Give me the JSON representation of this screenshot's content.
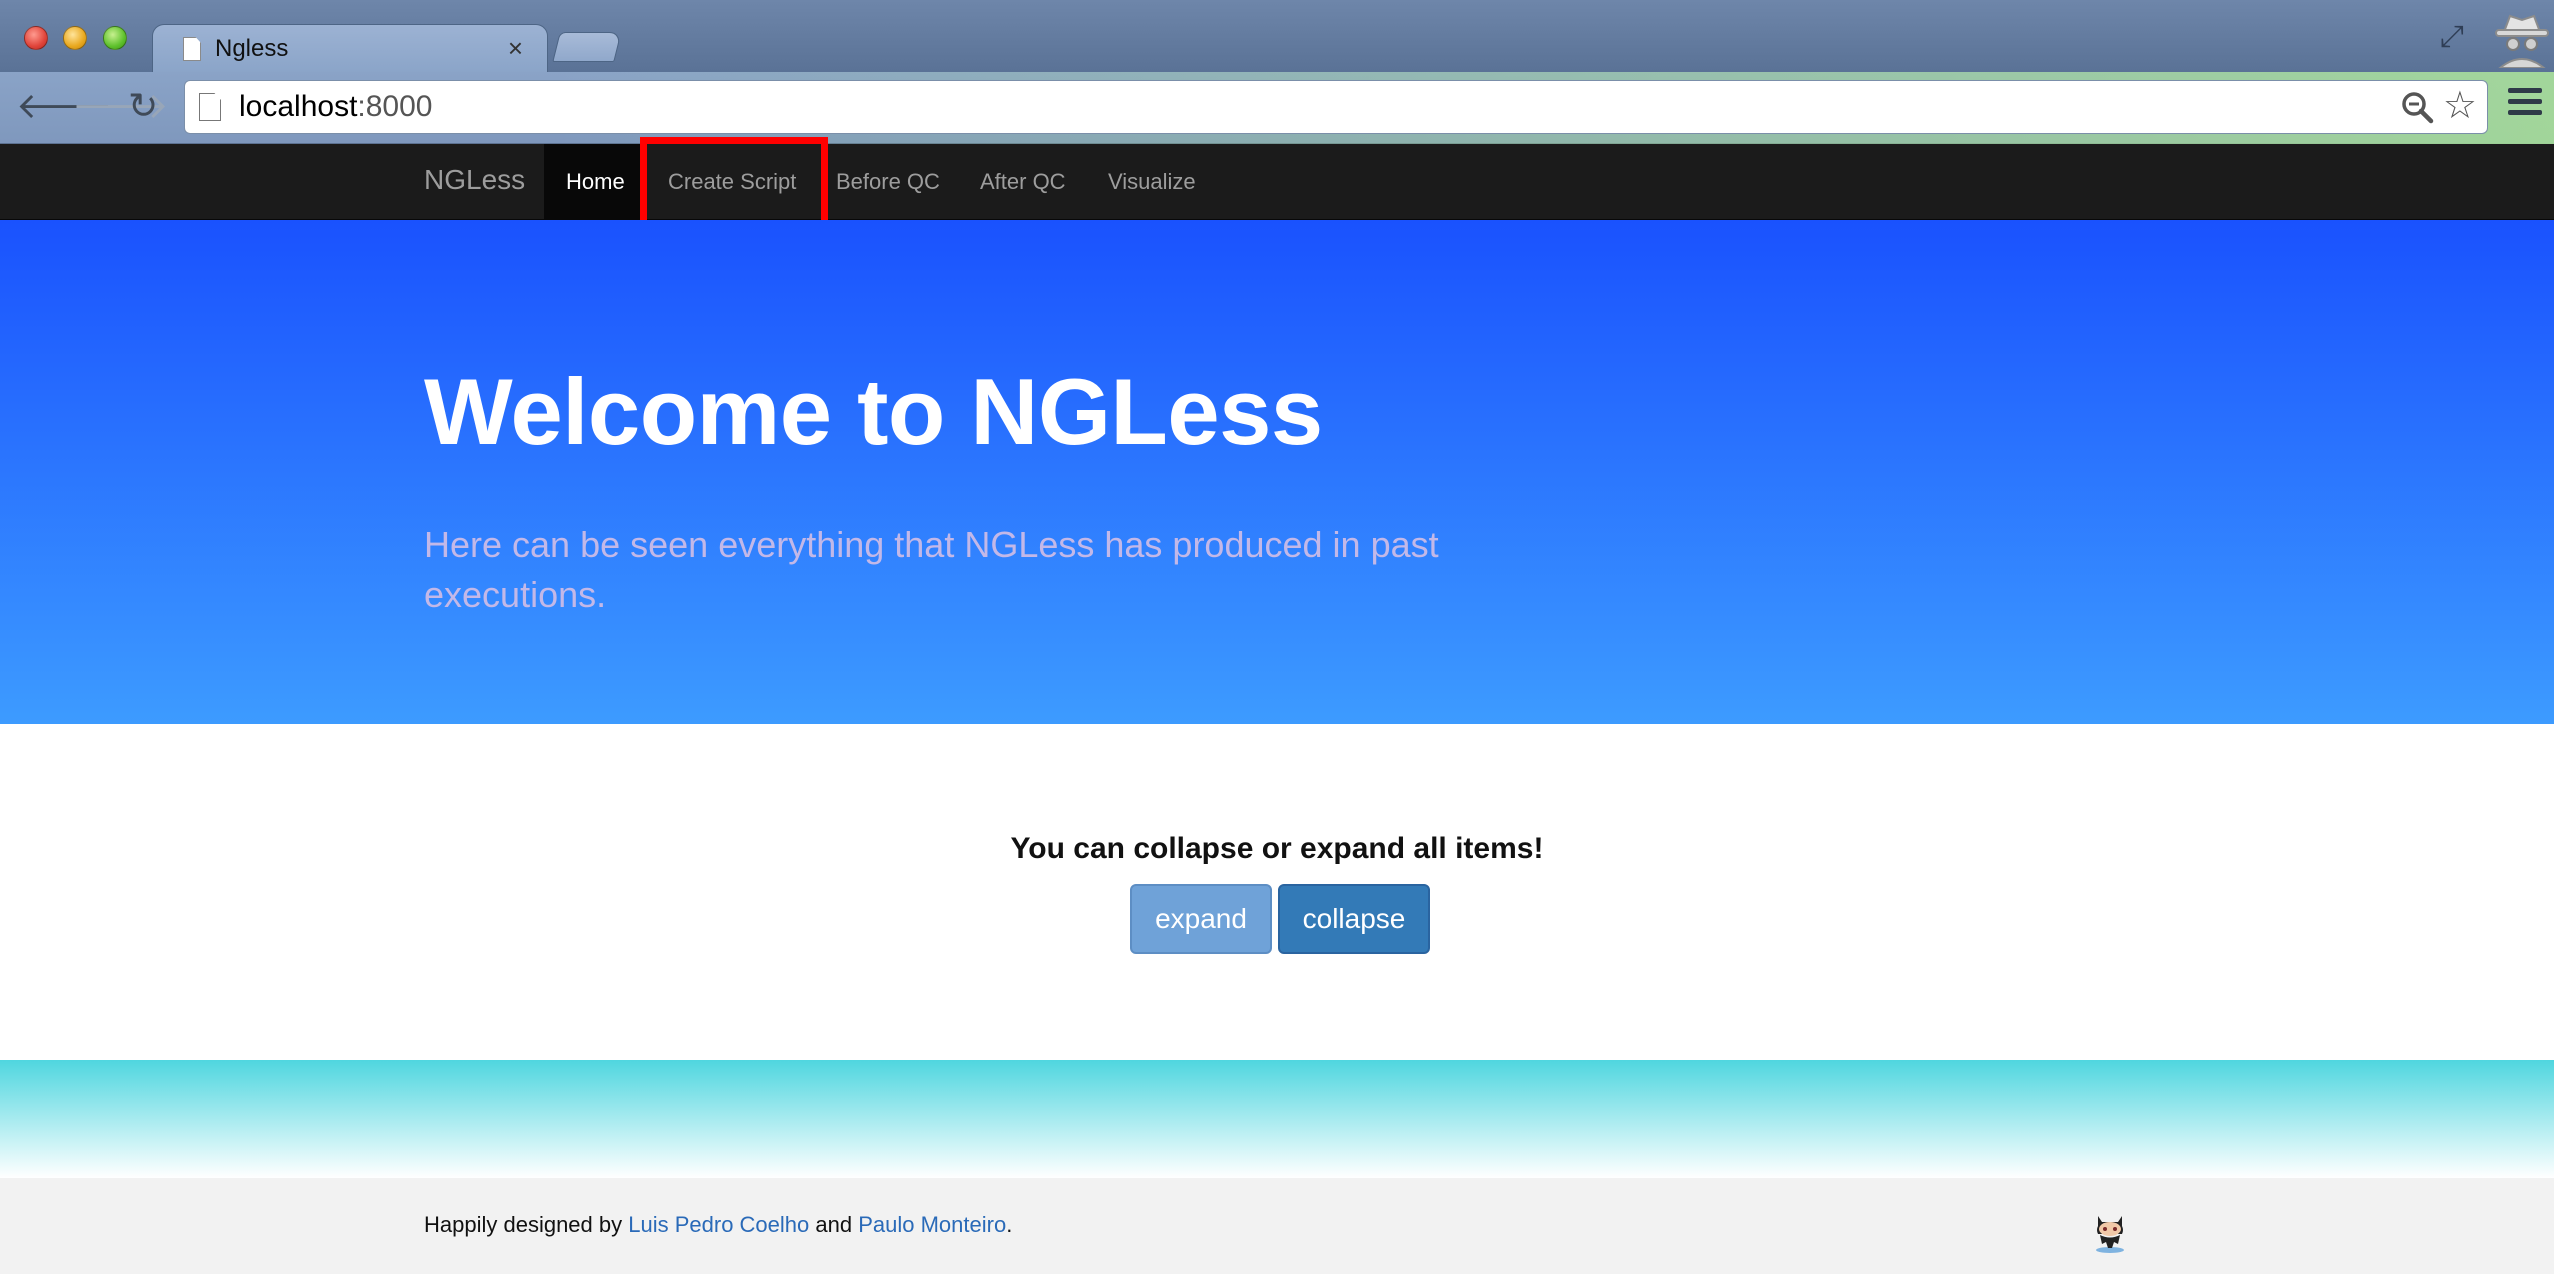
{
  "browser": {
    "tab_title": "Ngless",
    "tab_close": "×",
    "url_host": "localhost",
    "url_port": ":8000",
    "icons": [
      "back-icon",
      "forward-icon",
      "reload-icon",
      "page-icon",
      "zoom-icon",
      "bookmark-star-icon",
      "menu-icon",
      "fullscreen-icon",
      "incognito-icon"
    ]
  },
  "navbar": {
    "brand": "NGLess",
    "items": [
      {
        "label": "Home",
        "active": true
      },
      {
        "label": "Create Script",
        "active": false,
        "highlighted": true
      },
      {
        "label": "Before QC",
        "active": false
      },
      {
        "label": "After QC",
        "active": false
      },
      {
        "label": "Visualize",
        "active": false
      }
    ]
  },
  "jumbotron": {
    "title": "Welcome to NGLess",
    "subtitle": "Here can be seen everything that NGLess has produced in past executions."
  },
  "controls": {
    "heading": "You can collapse or expand all items!",
    "expand_label": "expand",
    "collapse_label": "collapse"
  },
  "footer": {
    "prefix": "Happily designed by ",
    "author1": "Luis Pedro Coelho",
    "joiner": " and ",
    "author2": "Paulo Monteiro",
    "suffix": ".",
    "icon": "github-octocat-icon"
  },
  "colors": {
    "navbar_bg": "#1b1b1b",
    "jumbotron_top": "#1a52fe",
    "jumbotron_bottom": "#3d9bff",
    "highlight": "#ff0000",
    "expand_btn": "#6fa2d8",
    "collapse_btn": "#337ab7",
    "link": "#2a6ab8",
    "teal": "#4fd6df"
  }
}
